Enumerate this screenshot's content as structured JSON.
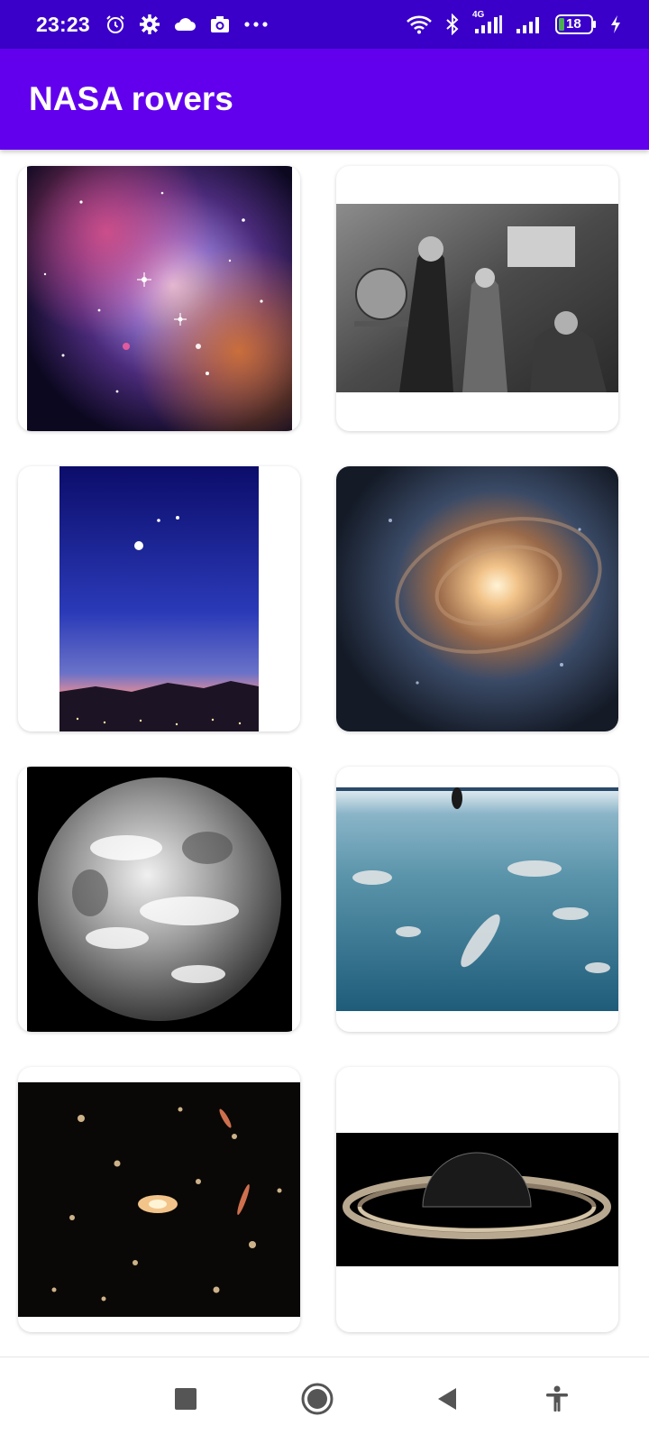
{
  "status_bar": {
    "time": "23:23",
    "network_label": "4G",
    "battery_level": "18",
    "left_icons": [
      "alarm-icon",
      "gear-icon",
      "cloud-icon",
      "camera-icon",
      "more-dots-icon"
    ],
    "right_icons": [
      "wifi-icon",
      "bluetooth-icon",
      "cell-signal-icon",
      "cell-signal-icon",
      "battery-icon",
      "charging-icon"
    ]
  },
  "app_bar": {
    "title": "NASA rovers"
  },
  "gallery": {
    "items": [
      {
        "subject": "nebula star cluster"
      },
      {
        "subject": "astronomers engraving"
      },
      {
        "subject": "night sky planets"
      },
      {
        "subject": "spiral galaxy"
      },
      {
        "subject": "earth globe"
      },
      {
        "subject": "earth from orbit"
      },
      {
        "subject": "galaxy cluster"
      },
      {
        "subject": "saturn rings"
      }
    ]
  },
  "nav_bar": {
    "buttons": [
      "recents-button",
      "home-button",
      "back-button",
      "accessibility-button"
    ]
  },
  "colors": {
    "status_bar": "#3a00c9",
    "app_bar": "#6200ee",
    "card": "#ffffff"
  }
}
